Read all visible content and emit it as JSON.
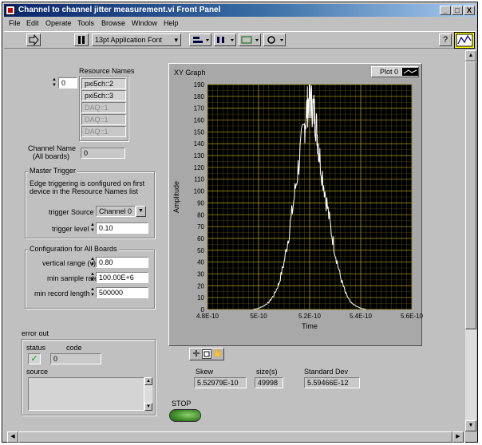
{
  "window": {
    "title": "Channel to channel jitter measurement.vi Front Panel",
    "controls": [
      "_",
      "□",
      "X"
    ]
  },
  "menu": [
    "File",
    "Edit",
    "Operate",
    "Tools",
    "Browse",
    "Window",
    "Help"
  ],
  "toolbar": {
    "font_select": "13pt Application Font",
    "help": "?"
  },
  "resource": {
    "index": "0",
    "label": "Resource Names",
    "names": [
      "pxi5ch::2",
      "pxi5ch::3",
      "DAQ::1",
      "DAQ::1",
      "DAQ::1"
    ]
  },
  "channel": {
    "label_line1": "Channel Name",
    "label_line2": "(All boards)",
    "value": "0"
  },
  "master_trigger": {
    "title": "Master Trigger",
    "desc_line1": "Edge triggering is configured on first",
    "desc_line2": "device in the Resource Names list",
    "source_label": "trigger Source",
    "source_value": "Channel 0",
    "level_label": "trigger level",
    "level_value": "0.10"
  },
  "config": {
    "title": "Configuration for All Boards",
    "vrange_label": "vertical range (v)",
    "vrange_value": "0.80",
    "rate_label": "min sample rate",
    "rate_value": "100.00E+6",
    "length_label": "min record length",
    "length_value": "500000"
  },
  "error_out": {
    "label": "error out",
    "status_label": "status",
    "code_label": "code",
    "code_value": "0",
    "source_label": "source",
    "status_check": "✓"
  },
  "graph": {
    "label": "XY Graph",
    "plot_legend": "Plot 0",
    "palette_icons": [
      "crosshair-icon",
      "zoom-icon",
      "pan-hand-icon"
    ]
  },
  "chart_data": {
    "type": "line",
    "title": "",
    "xlabel": "Time",
    "ylabel": "Amplitude",
    "xlim": [
      4.8e-10,
      5.6e-10
    ],
    "ylim": [
      0,
      190
    ],
    "x_ticks": [
      "4.8E-10",
      "5E-10",
      "5.2E-10",
      "5.4E-10",
      "5.6E-10"
    ],
    "y_ticks": [
      0,
      10,
      20,
      30,
      40,
      50,
      60,
      70,
      80,
      90,
      100,
      110,
      120,
      130,
      140,
      150,
      160,
      170,
      180,
      190
    ],
    "grid": true,
    "line_color": "#ffffff",
    "background": "#000000",
    "grid_color": "#9a8c1c",
    "series": [
      {
        "name": "Plot 0",
        "x": [
          4.98e-10,
          5e-10,
          5.02e-10,
          5.04e-10,
          5.06e-10,
          5.08e-10,
          5.1e-10,
          5.12e-10,
          5.14e-10,
          5.16e-10,
          5.18e-10,
          5.19e-10,
          5.2e-10,
          5.21e-10,
          5.22e-10,
          5.23e-10,
          5.24e-10,
          5.26e-10,
          5.28e-10,
          5.3e-10,
          5.32e-10,
          5.34e-10,
          5.36e-10,
          5.38e-10,
          5.4e-10,
          5.42e-10
        ],
        "y": [
          0,
          1,
          3,
          6,
          12,
          22,
          40,
          65,
          95,
          128,
          155,
          170,
          180,
          172,
          165,
          148,
          128,
          100,
          72,
          48,
          28,
          14,
          6,
          3,
          1,
          0
        ]
      }
    ]
  },
  "stats": {
    "skew_label": "Skew",
    "skew_value": "5.52979E-10",
    "size_label": "size(s)",
    "size_value": "49998",
    "std_label": "Standard Dev",
    "std_value": "5.59466E-12"
  },
  "stop": {
    "label": "STOP"
  }
}
